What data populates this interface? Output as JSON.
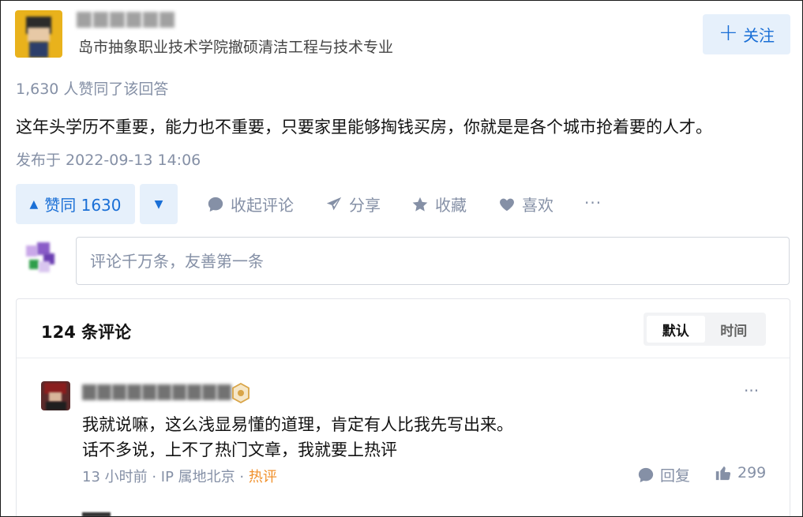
{
  "author": {
    "name": "",
    "bio": "岛市抽象职业技术学院撤硕清洁工程与技术专业",
    "follow_label": "关注"
  },
  "answer": {
    "vote_summary": "1,630 人赞同了该回答",
    "text": "这年头学历不重要，能力也不重要，只要家里能够掏钱买房，你就是是各个城市抢着要的人才。",
    "publish_time": "发布于 2022-09-13 14:06"
  },
  "actions": {
    "upvote_label": "赞同 1630",
    "collapse_comments": "收起评论",
    "share": "分享",
    "favorite": "收藏",
    "like": "喜欢",
    "more": "···"
  },
  "comment_input": {
    "placeholder": "评论千万条，友善第一条"
  },
  "comments_panel": {
    "title": "124 条评论",
    "sort_options": [
      "默认",
      "时间"
    ],
    "sort_selected": "默认",
    "comments": [
      {
        "text_line1": "我就说嘛，这么浅显易懂的道理，肯定有人比我先写出来。",
        "text_line2": "话不多说，上不了热门文章，我就要上热评",
        "meta_time": "13 小时前 · IP 属地北京 · ",
        "meta_hot": "热评",
        "reply_label": "回复",
        "like_count": "299"
      }
    ]
  },
  "colors": {
    "accent": "#1a6fd6",
    "accent_bg": "#e6f0fb",
    "muted": "#8590a6",
    "hot": "#f0912d"
  },
  "icons": [
    "plus-icon",
    "caret-up-icon",
    "caret-down-icon",
    "comment-icon",
    "share-icon",
    "star-icon",
    "heart-icon",
    "more-icon",
    "badge-icon",
    "thumb-up-icon"
  ]
}
